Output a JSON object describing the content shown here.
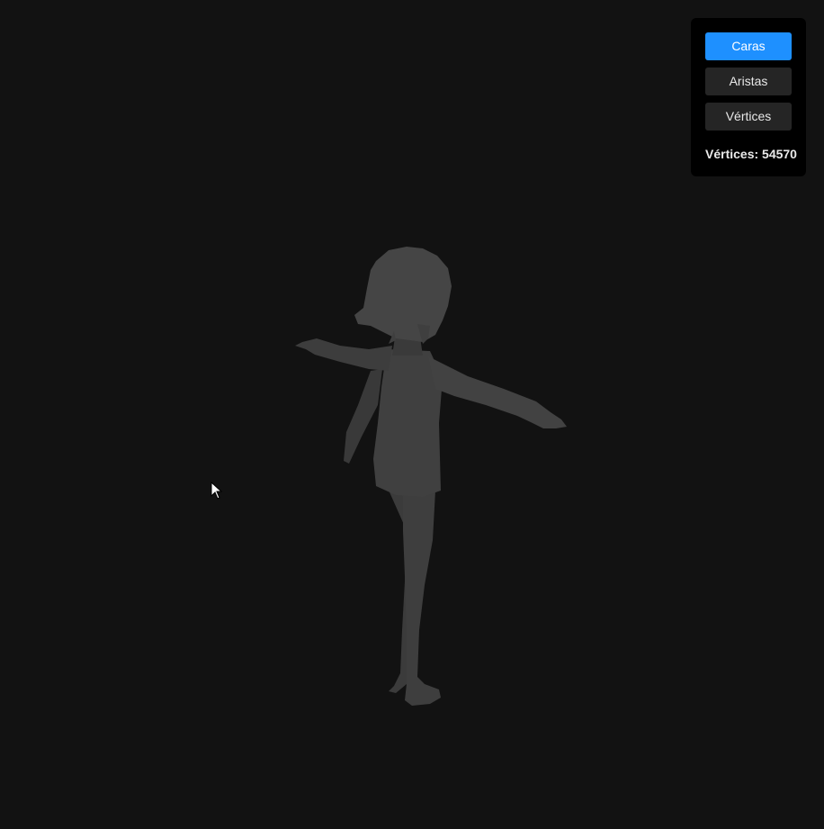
{
  "controls": {
    "buttons": [
      {
        "label": "Caras",
        "active": true
      },
      {
        "label": "Aristas",
        "active": false
      },
      {
        "label": "Vértices",
        "active": false
      }
    ],
    "vertex_count_label": "Vértices: 54570"
  },
  "colors": {
    "background": "#121212",
    "panel": "#000000",
    "active_button": "#1e90ff",
    "inactive_button": "#252525",
    "model": "#3a3a3a"
  },
  "viewport": {
    "render_mode": "Caras"
  }
}
